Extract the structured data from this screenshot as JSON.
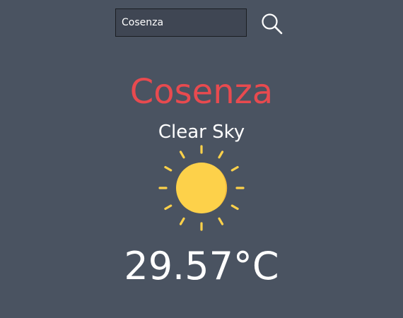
{
  "search": {
    "value": "Cosenza",
    "button_icon": "search-icon"
  },
  "weather": {
    "city": "Cosenza",
    "condition": "Clear Sky",
    "icon": "sun-icon",
    "temperature": "29.57°C"
  },
  "colors": {
    "background": "#4a5361",
    "city": "#e84a4f",
    "sun": "#fdd14a",
    "text": "#ffffff"
  }
}
